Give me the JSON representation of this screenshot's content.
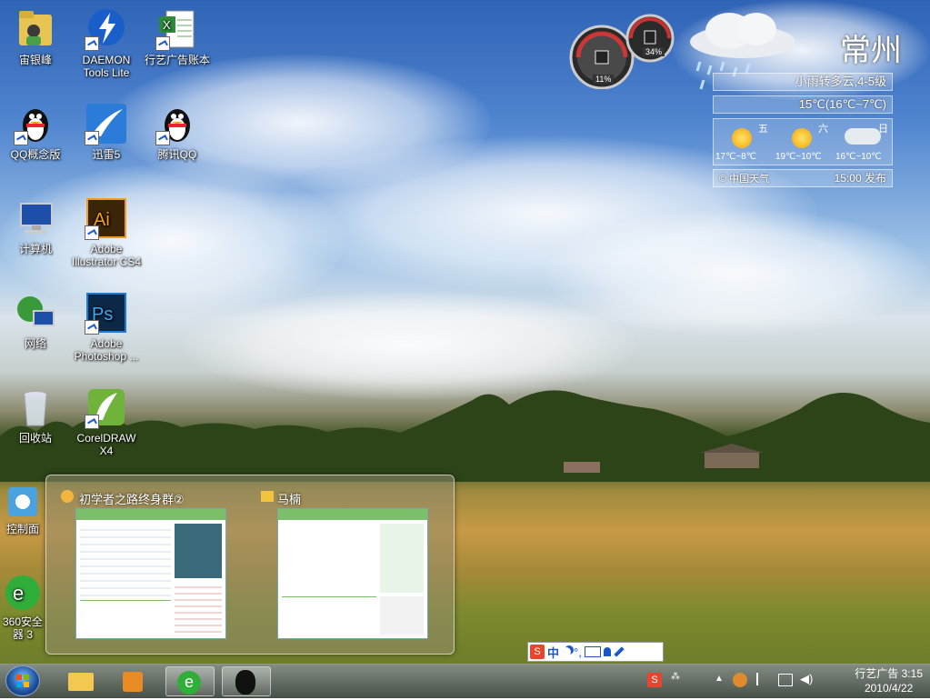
{
  "desktop_icons": [
    {
      "label": "宙银峰",
      "icon": "user-folder-icon"
    },
    {
      "label": "DAEMON Tools Lite",
      "icon": "daemon-tools-icon"
    },
    {
      "label": "行艺广告账本",
      "icon": "excel-sheet-icon"
    },
    {
      "label": "QQ概念版",
      "icon": "qq-penguin-icon"
    },
    {
      "label": "迅雷5",
      "icon": "thunder-icon"
    },
    {
      "label": "腾讯QQ",
      "icon": "qq-penguin-icon"
    },
    {
      "label": "计算机",
      "icon": "computer-icon"
    },
    {
      "label": "Adobe Illustrator CS4",
      "icon": "illustrator-icon"
    },
    {
      "label": "网络",
      "icon": "network-icon"
    },
    {
      "label": "Adobe Photoshop ...",
      "icon": "photoshop-icon"
    },
    {
      "label": "回收站",
      "icon": "recycle-bin-icon"
    },
    {
      "label": "CorelDRAW X4",
      "icon": "coreldraw-icon"
    },
    {
      "label": "控制面",
      "icon": "control-panel-icon"
    },
    {
      "label": "360安全 器 3",
      "icon": "browser-360-icon"
    }
  ],
  "cpu_gadget": {
    "cpu": "11%",
    "memory": "34%"
  },
  "weather": {
    "city": "常州",
    "condition": "小雨转多云,4-5级",
    "temp": "15℃(16℃~7℃)",
    "days": [
      {
        "day": "五",
        "range": "17℃~8℃",
        "icon": "sun-icon"
      },
      {
        "day": "六",
        "range": "19℃~10℃",
        "icon": "sun-icon"
      },
      {
        "day": "日",
        "range": "16℃~10℃",
        "icon": "rain-cloud-icon"
      }
    ],
    "source": "© 中国天气",
    "published": "15:00 发布"
  },
  "thumbnails": [
    {
      "title": "初学者之路终身群②",
      "icon": "group-chat-icon"
    },
    {
      "title": "马楠",
      "icon": "folder-icon"
    }
  ],
  "ime": {
    "mode": "中"
  },
  "clock": {
    "line1": "行艺广告 3:15",
    "date": "2010/4/22"
  },
  "colors": {
    "taskbar": "#4a5548",
    "sky": "#3f74c4",
    "weather_text": "#ffffff"
  }
}
